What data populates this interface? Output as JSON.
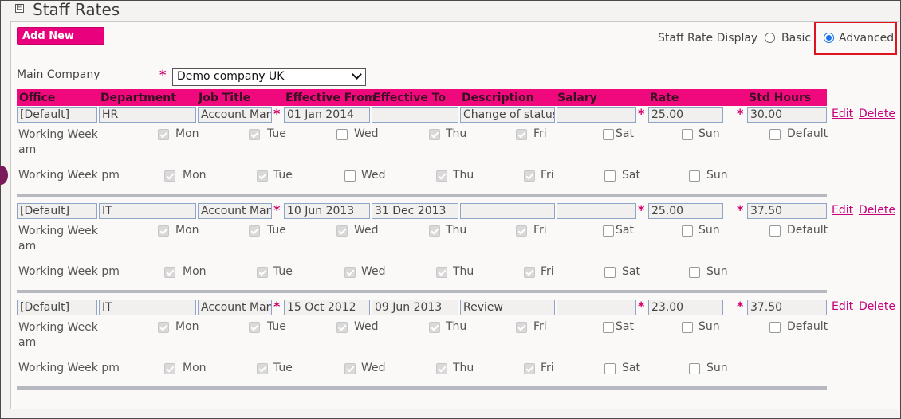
{
  "section": {
    "title": "Staff Rates",
    "expander_glyph": "⊟"
  },
  "toolbar": {
    "add_new_label": "Add New"
  },
  "display": {
    "label": "Staff Rate Display",
    "options": [
      {
        "label": "Basic",
        "selected": false
      },
      {
        "label": "Advanced",
        "selected": true
      }
    ]
  },
  "main_company": {
    "label": "Main Company",
    "required_mark": "*",
    "value": "Demo company UK"
  },
  "columns": [
    "Office",
    "Department",
    "Job Title",
    "Effective From",
    "Effective To",
    "Description",
    "Salary",
    "Rate",
    "Std Hours"
  ],
  "actions": {
    "edit": "Edit",
    "delete": "Delete"
  },
  "week_labels": {
    "am_line1": "Working Week",
    "am_line2": "am",
    "pm": "Working Week pm",
    "default": "Default"
  },
  "days": [
    "Mon",
    "Tue",
    "Wed",
    "Thu",
    "Fri",
    "Sat",
    "Sun"
  ],
  "rows": [
    {
      "office": "[Default]",
      "department": "HR",
      "job_title": "Account Manager",
      "effective_from": "01 Jan 2014",
      "effective_to": "",
      "description": "Change of status f",
      "salary": "",
      "rate": "25.00",
      "std_hours": "30.00",
      "am": [
        true,
        true,
        false,
        true,
        true,
        false,
        false
      ],
      "am_default": false,
      "pm": [
        true,
        true,
        false,
        true,
        true,
        false,
        false
      ]
    },
    {
      "office": "[Default]",
      "department": "IT",
      "job_title": "Account Manager",
      "effective_from": "10 Jun 2013",
      "effective_to": "31 Dec 2013",
      "description": "",
      "salary": "",
      "rate": "25.00",
      "std_hours": "37.50",
      "am": [
        true,
        true,
        true,
        true,
        true,
        false,
        false
      ],
      "am_default": false,
      "pm": [
        true,
        true,
        true,
        true,
        true,
        false,
        false
      ]
    },
    {
      "office": "[Default]",
      "department": "IT",
      "job_title": "Account Manager",
      "effective_from": "15 Oct 2012",
      "effective_to": "09 Jun 2013",
      "description": "Review",
      "salary": "",
      "rate": "23.00",
      "std_hours": "37.50",
      "am": [
        true,
        true,
        true,
        true,
        true,
        false,
        false
      ],
      "am_default": false,
      "pm": [
        true,
        true,
        true,
        true,
        true,
        false,
        false
      ]
    }
  ]
}
